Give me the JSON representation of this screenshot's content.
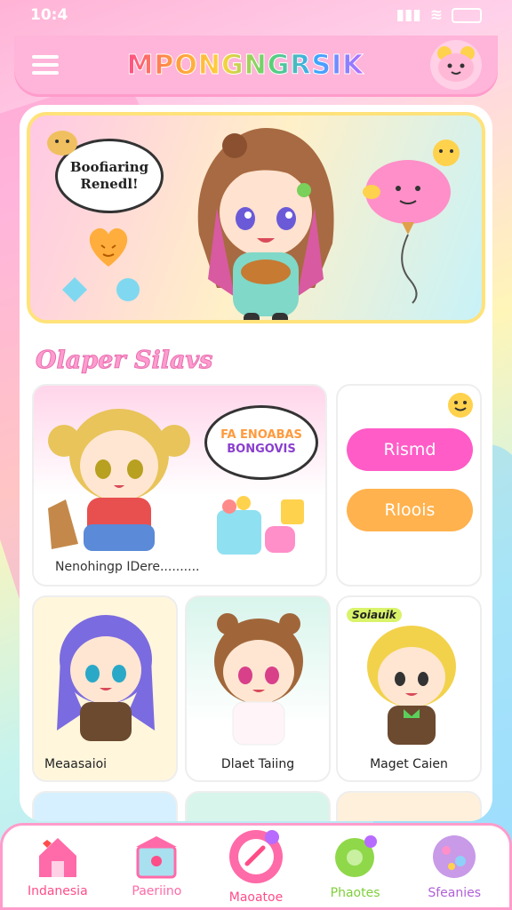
{
  "status": {
    "time": "10:4"
  },
  "header": {
    "logo_text": "MPONGNGRSIK",
    "menu_icon": "hamburger-menu-icon",
    "mascot_icon": "bear-mascot-icon"
  },
  "hero": {
    "speech_text": "Boofiaring Renedl!",
    "character": "girl-holding-bread",
    "balloon": "pink-cloud-balloon"
  },
  "section": {
    "title": "Olaper Silavs"
  },
  "featured": {
    "bubble_line1": "FA ENOABAS",
    "bubble_line2": "BONGOVIS",
    "caption": "Nenohingp IDere.........."
  },
  "side_actions": {
    "primary_label": "Rismd",
    "secondary_label": "Rloois"
  },
  "characters": [
    {
      "label": "Meaasaioi",
      "hair": "#7b6be0"
    },
    {
      "label": "Dlaet Taiing",
      "hair": "#a0663a"
    },
    {
      "label": "Maget Caien",
      "hair": "#f2d24b",
      "tag": "Soiauik"
    }
  ],
  "tabs": [
    {
      "label": "Indanesia",
      "color": "#ff4d88",
      "icon": "home-icon"
    },
    {
      "label": "Paeriino",
      "color": "#ff6aa8",
      "icon": "shop-icon"
    },
    {
      "label": "Maoatoe",
      "color": "#ff4d88",
      "icon": "timer-icon"
    },
    {
      "label": "Phaotes",
      "color": "#7fcf3a",
      "icon": "bubble-icon"
    },
    {
      "label": "Sfeanies",
      "color": "#c267e0",
      "icon": "planet-icon"
    }
  ]
}
